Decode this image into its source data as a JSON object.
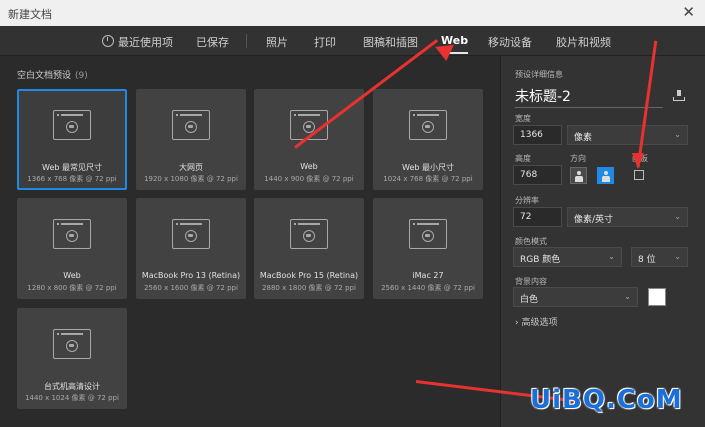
{
  "window": {
    "title": "新建文档",
    "close_glyph": "✕"
  },
  "tabs": [
    {
      "label": "最近使用项"
    },
    {
      "label": "已保存"
    },
    {
      "label": "照片"
    },
    {
      "label": "打印"
    },
    {
      "label": "图稿和插图"
    },
    {
      "label": "Web",
      "active": true
    },
    {
      "label": "移动设备"
    },
    {
      "label": "胶片和视频"
    }
  ],
  "presets": {
    "title": "空白文档预设",
    "count": "(9)",
    "items": [
      {
        "name": "Web 最常见尺寸",
        "size": "1366 x 768 像素 @ 72 ppi",
        "selected": true
      },
      {
        "name": "大网页",
        "size": "1920 x 1080 像素 @ 72 ppi"
      },
      {
        "name": "Web",
        "size": "1440 x 900 像素 @ 72 ppi"
      },
      {
        "name": "Web 最小尺寸",
        "size": "1024 x 768 像素 @ 72 ppi"
      },
      {
        "name": "Web",
        "size": "1280 x 800 像素 @ 72 ppi"
      },
      {
        "name": "MacBook Pro 13 (Retina)",
        "size": "2560 x 1600 像素 @ 72 ppi"
      },
      {
        "name": "MacBook Pro 15 (Retina)",
        "size": "2880 x 1800 像素 @ 72 ppi"
      },
      {
        "name": "iMac 27",
        "size": "2560 x 1440 像素 @ 72 ppi"
      },
      {
        "name": "台式机高清设计",
        "size": "1440 x 1024 像素 @ 72 ppi"
      }
    ]
  },
  "details": {
    "header": "预设详细信息",
    "doc_name": "未标题-2",
    "width_label": "宽度",
    "width_value": "1366",
    "width_unit": "像素",
    "height_label": "高度",
    "height_value": "768",
    "orientation_label": "方向",
    "artboard_label": "画板",
    "resolution_label": "分辨率",
    "resolution_value": "72",
    "resolution_unit": "像素/英寸",
    "color_mode_label": "颜色模式",
    "color_mode_value": "RGB 颜色",
    "bit_depth_value": "8 位",
    "background_label": "背景内容",
    "background_value": "白色",
    "background_color": "#ffffff",
    "advanced_label": "高级选项"
  },
  "watermark": "UiBQ.CoM",
  "colors": {
    "accent": "#1f8ae6",
    "annotation": "#e8322f"
  }
}
